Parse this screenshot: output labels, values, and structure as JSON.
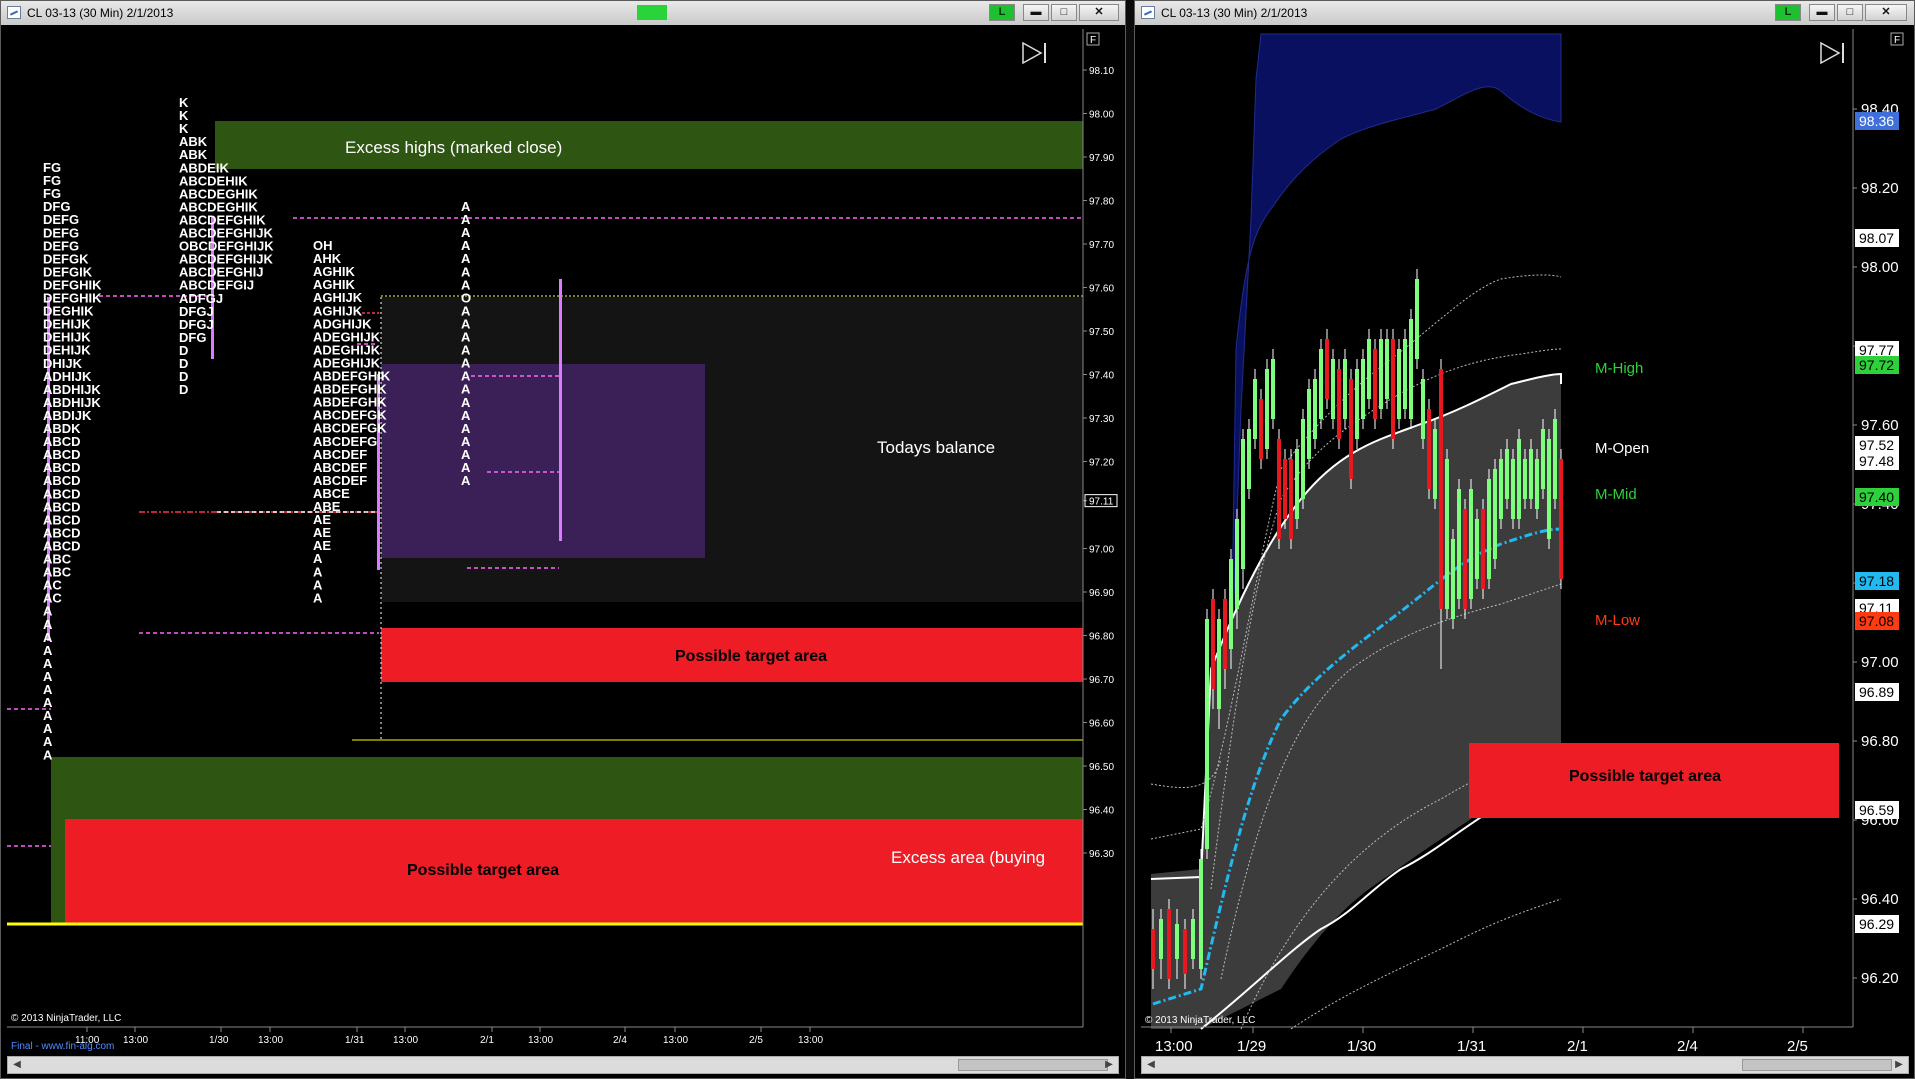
{
  "colors": {
    "background": "#000000",
    "excess_green": "#2e5512",
    "target_red": "#ee1c25",
    "balance_purple": "#3b1f57",
    "value_area_magenta": "#d97cff",
    "poc_magenta": "#ff66ff",
    "yellow_line": "#ffff00",
    "band_blue": "#091060",
    "band_gray": "#3c3c3c",
    "vwap_cyan": "#22b8f0",
    "m_high": "#2ed13b",
    "m_mid": "#2ed13b",
    "m_low": "#ff3b12",
    "m_open": "#ffffff"
  },
  "left_window": {
    "title": "CL 03-13 (30 Min)  2/1/2013",
    "buttons": {
      "link": "L",
      "minimize": "▬",
      "maximize": "□",
      "close": "✕"
    },
    "skip_icon": "skip-to-end-icon",
    "f_badge": "F",
    "price_axis": [
      "98.10",
      "98.00",
      "97.90",
      "97.80",
      "97.70",
      "97.60",
      "97.50",
      "97.40",
      "97.30",
      "97.20",
      "97.11",
      "97.00",
      "96.90",
      "96.80",
      "96.70",
      "96.60",
      "96.50",
      "96.40",
      "96.30"
    ],
    "time_axis": [
      "11:00",
      "13:00",
      "1/30",
      "13:00",
      "1/31",
      "13:00",
      "2/1",
      "13:00",
      "2/4",
      "13:00",
      "2/5",
      "13:00"
    ],
    "copyright": "© 2013 NinjaTrader, LLC",
    "footer_link": "Final - www.fin-alg.com",
    "annotations": {
      "excess_highs": "Excess highs (marked close)",
      "todays_balance": "Todays balance",
      "target_top": "Possible target area",
      "target_bottom": "Possible target area",
      "excess_area": "Excess area (buying"
    },
    "profiles": [
      {
        "name": "profile-1-29",
        "rows": [
          "FG",
          "FG",
          "FG",
          "DFG",
          "DEFG",
          "DEFG",
          "DEFG",
          "DEFGK",
          "DEFGIK",
          "DEFGHIK",
          "DEFGHIK",
          "DEGHIK",
          "DEHIJK",
          "DEHIJK",
          "DEHIJK",
          "DHIJK",
          "ADHIJK",
          "ABDHIJK",
          "ABDHIJK",
          "ABDIJK",
          "ABDK",
          "ABCD",
          "ABCD",
          "ABCD",
          "ABCD",
          "ABCD",
          "ABCD",
          "ABCD",
          "ABCD",
          "ABCD",
          "ABC",
          "ABC",
          "AC",
          "AC",
          "A",
          "A",
          "A",
          "A",
          "A",
          "A",
          "A",
          "A",
          "A",
          "A",
          "A",
          "A"
        ]
      },
      {
        "name": "profile-1-30",
        "rows": [
          "K",
          "K",
          "K",
          "ABK",
          "ABK",
          "ABDEIK",
          "ABCDEHIK",
          "ABCDEGHIK",
          "ABCDEGHIK",
          "ABCDEFGHIK",
          "ABCDEFGHIJK",
          "OBCDEFGHIJK",
          "ABCDEFGHIJK",
          "ABCDEFGHIJ",
          "ABCDEFGIJ",
          "ADFGJ",
          "DFGJ",
          "DFGJ",
          "DFG",
          "D",
          "D",
          "D",
          "D"
        ]
      },
      {
        "name": "profile-1-31",
        "rows": [
          "OH",
          "AHK",
          "AGHIK",
          "AGHIK",
          "AGHIJK",
          "AGHIJK",
          "ADGHIJK",
          "ADEGHIJK",
          "ADEGHIJK",
          "ADEGHIJK",
          "ABDEFGHIK",
          "ABDEFGHK",
          "ABDEFGHK",
          "ABCDEFGK",
          "ABCDEFGK",
          "ABCDEFG",
          "ABCDEF",
          "ABCDEF",
          "ABCDEF",
          "ABCE",
          "ABE",
          "AE",
          "AE",
          "AE",
          "A",
          "A",
          "A",
          "A"
        ]
      },
      {
        "name": "profile-2-1",
        "rows": [
          "A",
          "A",
          "A",
          "A",
          "A",
          "A",
          "A",
          "O",
          "A",
          "A",
          "A",
          "A",
          "A",
          "A",
          "A",
          "A",
          "A",
          "A",
          "A",
          "A",
          "A",
          "A"
        ]
      }
    ]
  },
  "right_window": {
    "title": "CL 03-13 (30 Min)  2/1/2013",
    "buttons": {
      "link": "L",
      "minimize": "▬",
      "maximize": "□",
      "close": "✕"
    },
    "skip_icon": "skip-to-end-icon",
    "f_badge": "F",
    "price_axis": [
      "98.40",
      "98.20",
      "98.00",
      "97.80",
      "97.60",
      "97.40",
      "97.20",
      "97.00",
      "96.80",
      "96.60",
      "96.40",
      "96.20"
    ],
    "price_tags": [
      {
        "value": "98.36",
        "bg": "#3f6fd8",
        "fg": "#ffffff"
      },
      {
        "value": "98.07",
        "bg": "#ffffff",
        "fg": "#000000"
      },
      {
        "value": "97.77",
        "bg": "#ffffff",
        "fg": "#000000"
      },
      {
        "value": "97.72",
        "bg": "#2ed13b",
        "fg": "#000000"
      },
      {
        "value": "97.52",
        "bg": "#ffffff",
        "fg": "#000000"
      },
      {
        "value": "97.48",
        "bg": "#ffffff",
        "fg": "#000000"
      },
      {
        "value": "97.40",
        "bg": "#2ed13b",
        "fg": "#000000"
      },
      {
        "value": "97.18",
        "bg": "#22b8f0",
        "fg": "#000000"
      },
      {
        "value": "97.11",
        "bg": "#ffffff",
        "fg": "#000000"
      },
      {
        "value": "97.08",
        "bg": "#ff3b12",
        "fg": "#000000"
      },
      {
        "value": "96.89",
        "bg": "#ffffff",
        "fg": "#000000"
      },
      {
        "value": "96.59",
        "bg": "#ffffff",
        "fg": "#000000"
      },
      {
        "value": "96.29",
        "bg": "#ffffff",
        "fg": "#000000"
      }
    ],
    "time_axis": [
      "13:00",
      "1/29",
      "1/30",
      "1/31",
      "2/1",
      "2/4",
      "2/5"
    ],
    "copyright": "© 2013 NinjaTrader, LLC",
    "labels": {
      "m_high": "M-High",
      "m_open": "M-Open",
      "m_mid": "M-Mid",
      "m_low": "M-Low",
      "target": "Possible target area"
    }
  }
}
